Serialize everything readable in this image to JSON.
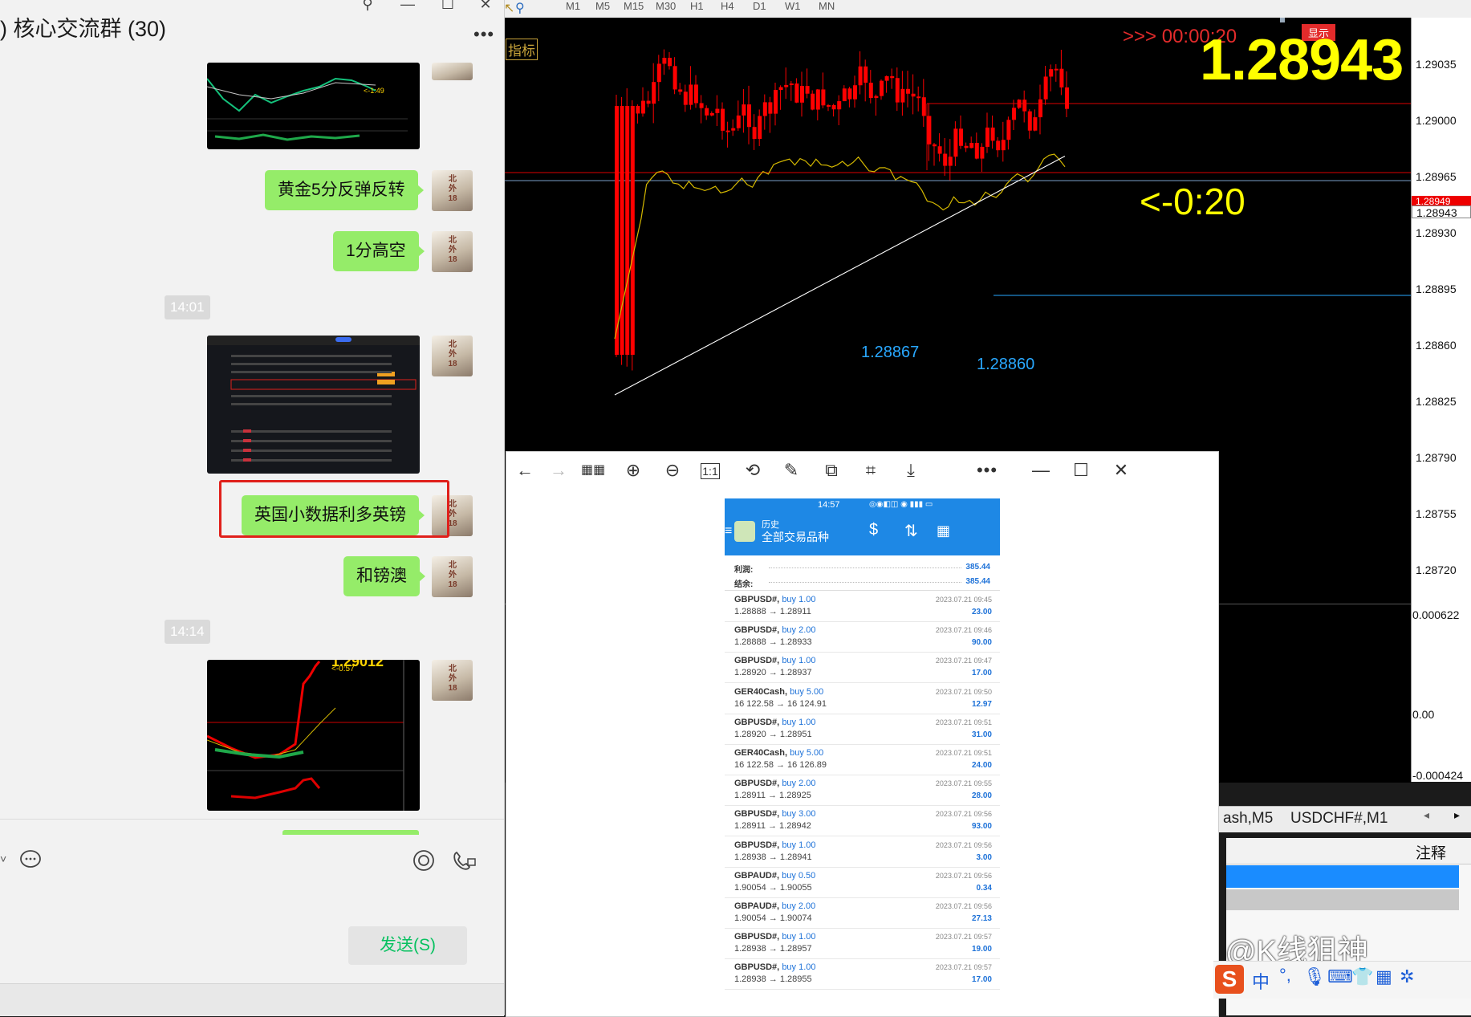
{
  "chat": {
    "title": ") 核心交流群 (30)",
    "messages": [
      {
        "type": "text",
        "text": "黄金5分反弹反转"
      },
      {
        "type": "text",
        "text": "1分高空"
      },
      {
        "type": "time",
        "text": "14:01"
      },
      {
        "type": "text",
        "text": "英国小数据利多英镑",
        "highlighted": true
      },
      {
        "type": "text",
        "text": "和镑澳"
      },
      {
        "type": "time",
        "text": "14:14"
      }
    ],
    "send_label": "发送(S)"
  },
  "trading": {
    "timeframes": [
      "M1",
      "M5",
      "M15",
      "M30",
      "H1",
      "H4",
      "D1",
      "W1",
      "MN"
    ],
    "indicator_label": "指标",
    "countdown": ">>> 00:00:20",
    "display_badge": "显示",
    "bid_big": "1.28943",
    "arrow_countdown": "<-0:20",
    "low_labels": [
      "1.28867",
      "1.28860"
    ],
    "price_ticks": [
      "1.29035",
      "1.29000",
      "1.28965",
      "1.28930",
      "1.28895",
      "1.28860",
      "1.28825",
      "1.28790",
      "1.28755",
      "1.28720"
    ],
    "price_marker": "1.28943",
    "price_marker_red": "1.28949",
    "osc_ticks": [
      "0.000622",
      "0.00",
      "-0.000424"
    ],
    "symbol_tabs": [
      "ash,M5",
      "USDCHF#,M1"
    ],
    "comment_header": "注释",
    "colors": {
      "bull": "#ff0000",
      "bear": "#ff0000",
      "ma_fast": "#d4b800",
      "ma_slow": "#ffffff",
      "low_line": "#29a8ff"
    }
  },
  "viewer": {
    "status_time": "14:57",
    "header_title": "历史",
    "header_subtitle": "全部交易品种",
    "profit_label": "利润:",
    "profit_value": "385.44",
    "balance_label": "结余:",
    "balance_value": "385.44",
    "trades": [
      {
        "symbol": "GBPUSD#,",
        "action": "buy 1.00",
        "prices": "1.28888 → 1.28911",
        "time": "2023.07.21 09:45",
        "profit": "23.00"
      },
      {
        "symbol": "GBPUSD#,",
        "action": "buy 2.00",
        "prices": "1.28888 → 1.28933",
        "time": "2023.07.21 09:46",
        "profit": "90.00"
      },
      {
        "symbol": "GBPUSD#,",
        "action": "buy 1.00",
        "prices": "1.28920 → 1.28937",
        "time": "2023.07.21 09:47",
        "profit": "17.00"
      },
      {
        "symbol": "GER40Cash,",
        "action": "buy 5.00",
        "prices": "16 122.58 → 16 124.91",
        "time": "2023.07.21 09:50",
        "profit": "12.97"
      },
      {
        "symbol": "GBPUSD#,",
        "action": "buy 1.00",
        "prices": "1.28920 → 1.28951",
        "time": "2023.07.21 09:51",
        "profit": "31.00"
      },
      {
        "symbol": "GER40Cash,",
        "action": "buy 5.00",
        "prices": "16 122.58 → 16 126.89",
        "time": "2023.07.21 09:51",
        "profit": "24.00"
      },
      {
        "symbol": "GBPUSD#,",
        "action": "buy 2.00",
        "prices": "1.28911 → 1.28925",
        "time": "2023.07.21 09:55",
        "profit": "28.00"
      },
      {
        "symbol": "GBPUSD#,",
        "action": "buy 3.00",
        "prices": "1.28911 → 1.28942",
        "time": "2023.07.21 09:56",
        "profit": "93.00"
      },
      {
        "symbol": "GBPUSD#,",
        "action": "buy 1.00",
        "prices": "1.28938 → 1.28941",
        "time": "2023.07.21 09:56",
        "profit": "3.00"
      },
      {
        "symbol": "GBPAUD#,",
        "action": "buy 0.50",
        "prices": "1.90054 → 1.90055",
        "time": "2023.07.21 09:56",
        "profit": "0.34"
      },
      {
        "symbol": "GBPAUD#,",
        "action": "buy 2.00",
        "prices": "1.90054 → 1.90074",
        "time": "2023.07.21 09:56",
        "profit": "27.13"
      },
      {
        "symbol": "GBPUSD#,",
        "action": "buy 1.00",
        "prices": "1.28938 → 1.28957",
        "time": "2023.07.21 09:57",
        "profit": "19.00"
      },
      {
        "symbol": "GBPUSD#,",
        "action": "buy 1.00",
        "prices": "1.28938 → 1.28955",
        "time": "2023.07.21 09:57",
        "profit": "17.00"
      }
    ]
  },
  "watermark": "@K线狙神"
}
